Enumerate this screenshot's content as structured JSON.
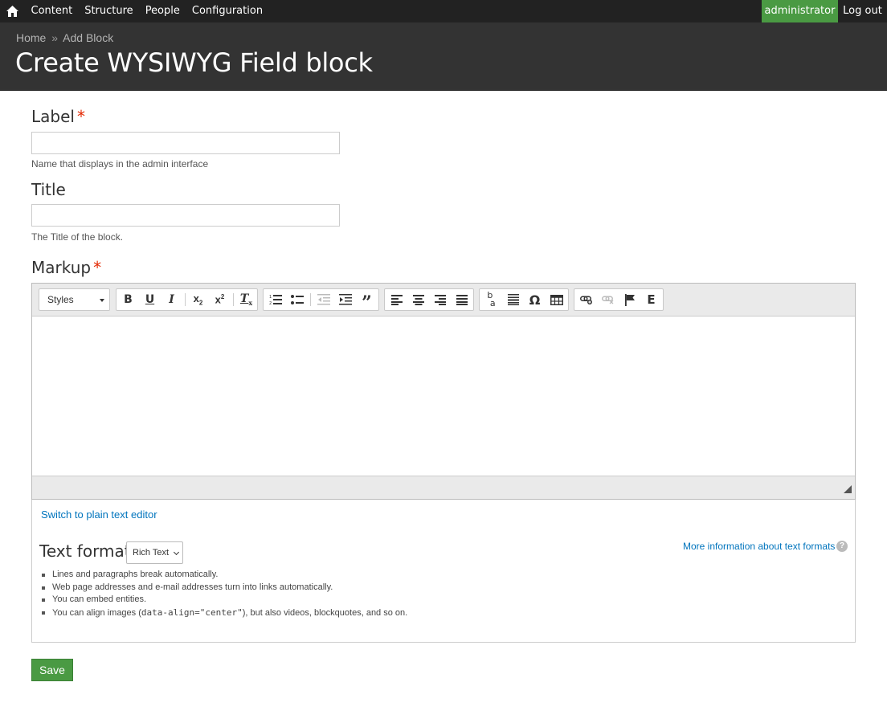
{
  "toolbar": {
    "home_icon": "home-icon",
    "nav": [
      "Content",
      "Structure",
      "People",
      "Configuration"
    ],
    "user": "administrator",
    "logout": "Log out"
  },
  "header": {
    "breadcrumb": [
      "Home",
      "Add Block"
    ],
    "breadcrumb_separator": "»",
    "title": "Create WYSIWYG Field block"
  },
  "form": {
    "label": {
      "label": "Label",
      "required_mark": "*",
      "value": "",
      "description": "Name that displays in the admin interface"
    },
    "title": {
      "label": "Title",
      "value": "",
      "description": "The Title of the block."
    },
    "markup": {
      "label": "Markup",
      "required_mark": "*"
    }
  },
  "editor": {
    "styles_label": "Styles",
    "buttons": [
      "bold",
      "underline",
      "italic",
      "subscript",
      "superscript",
      "remove-format",
      "numbered-list",
      "bulleted-list",
      "outdent",
      "indent",
      "blockquote",
      "align-left",
      "align-center",
      "align-right",
      "justify",
      "language",
      "horizontal-rule",
      "special-character",
      "table",
      "link",
      "unlink",
      "anchor",
      "embed"
    ],
    "switch_link": "Switch to plain text editor"
  },
  "text_format": {
    "label": "Text format",
    "selected": "Rich Text",
    "more_info": "More information about text formats",
    "help_icon": "help-icon",
    "tips": {
      "t1": "Lines and paragraphs break automatically.",
      "t2": "Web page addresses and e-mail addresses turn into links automatically.",
      "t3": "You can embed entities.",
      "t4_pre": "You can align images (",
      "t4_code": "data-align=\"center\"",
      "t4_post": "), but also videos, blockquotes, and so on."
    }
  },
  "actions": {
    "save": "Save"
  },
  "colors": {
    "accent_green": "#4a9a43",
    "link_blue": "#0074bd",
    "header_bg": "#333333",
    "toolbar_bg": "#222222",
    "required_red": "#e32700"
  }
}
